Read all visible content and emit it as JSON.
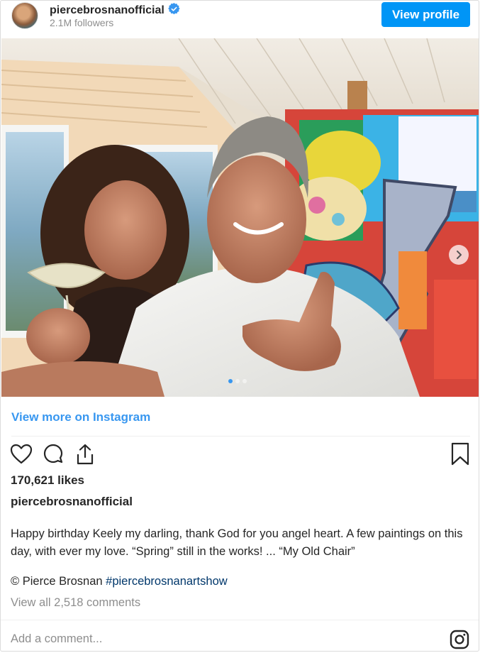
{
  "header": {
    "username": "piercebrosnanofficial",
    "followers": "2.1M followers",
    "view_profile_label": "View profile"
  },
  "carousel": {
    "total_slides": 3,
    "active_slide": 1
  },
  "actions": {
    "view_more_label": "View more on Instagram"
  },
  "post": {
    "likes": "170,621 likes",
    "caption_username": "piercebrosnanofficial",
    "caption": "Happy birthday Keely my darling, thank God for you angel heart. A few paintings on this day, with ever my love. “Spring” still in the works! ... “My Old Chair”",
    "credit_prefix": "© Pierce Brosnan ",
    "hashtag": "#piercebrosnanartshow",
    "view_all_comments": "View all 2,518 comments"
  },
  "comment": {
    "placeholder": "Add a comment..."
  },
  "colors": {
    "accent": "#0095f6",
    "link": "#3897f0",
    "hashtag": "#00376b",
    "muted": "#8e8e8e"
  },
  "icons": [
    "verified-badge-icon",
    "heart-icon",
    "comment-icon",
    "share-icon",
    "bookmark-icon",
    "chevron-right-icon",
    "instagram-logo-icon"
  ]
}
